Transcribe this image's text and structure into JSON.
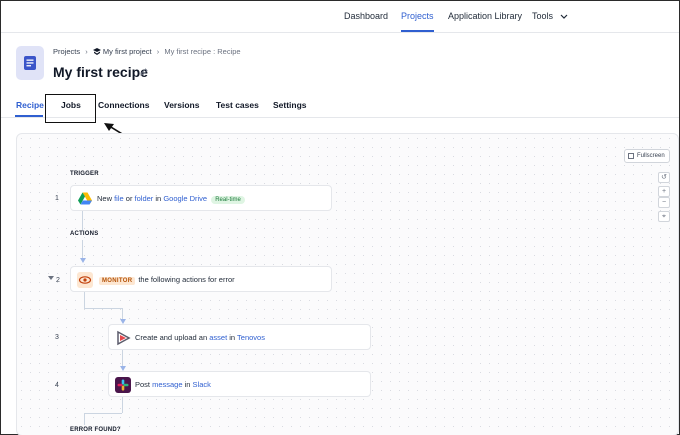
{
  "nav": {
    "items": [
      {
        "label": "Dashboard",
        "active": false
      },
      {
        "label": "Projects",
        "active": true
      },
      {
        "label": "Application Library",
        "active": false
      },
      {
        "label": "Tools",
        "active": false
      }
    ]
  },
  "header": {
    "breadcrumb": [
      "Projects",
      "My first project",
      "My first recipe : Recipe"
    ],
    "title": "My first recipe"
  },
  "tabs": [
    "Recipe",
    "Jobs",
    "Connections",
    "Versions",
    "Test cases",
    "Settings"
  ],
  "canvas": {
    "fullscreen_label": "Fullscreen",
    "zoom_controls": [
      "↺",
      "+",
      "−",
      "⌖"
    ],
    "trigger_label": "TRIGGER",
    "actions_label": "ACTIONS",
    "error_label": "ERROR FOUND?",
    "steps": [
      {
        "num": "1",
        "parts": [
          "New ",
          "file",
          " or ",
          "folder",
          " in ",
          "Google Drive"
        ],
        "badge": "Real-time"
      },
      {
        "num": "2",
        "badge": "MONITOR",
        "text": "the following actions for error"
      },
      {
        "num": "3",
        "parts": [
          "Create and upload an ",
          "asset",
          " in ",
          "Tenovos"
        ]
      },
      {
        "num": "4",
        "parts": [
          "Post ",
          "message",
          " in ",
          "Slack"
        ]
      }
    ]
  },
  "colors": {
    "accent": "#2f5fd0",
    "realtime_bg": "#dff5e3",
    "monitor_bg": "#fde7d2"
  }
}
